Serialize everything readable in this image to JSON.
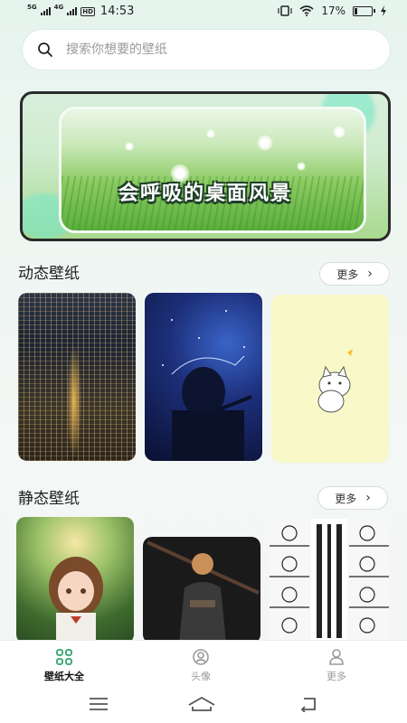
{
  "status_bar": {
    "network_1": "5G",
    "network_2": "4G",
    "hd": "HD",
    "time": "14:53",
    "battery_percent": "17%",
    "battery_level": 0.17
  },
  "search": {
    "placeholder": "搜索你想要的壁纸"
  },
  "banner": {
    "title": "会呼吸的桌面风景"
  },
  "sections": {
    "dynamic": {
      "title": "动态壁纸",
      "more_label": "更多"
    },
    "static": {
      "title": "静态壁纸",
      "more_label": "更多"
    }
  },
  "bottom_nav": {
    "items": [
      {
        "label": "壁纸大全",
        "icon": "grid-icon",
        "active": true
      },
      {
        "label": "头像",
        "icon": "avatar-icon",
        "active": false
      },
      {
        "label": "更多",
        "icon": "person-icon",
        "active": false
      }
    ]
  },
  "system_nav": {
    "icons": [
      "menu-icon",
      "home-icon",
      "back-icon"
    ]
  },
  "colors": {
    "accent_green": "#2fa86a",
    "background": "#eef6f2"
  }
}
